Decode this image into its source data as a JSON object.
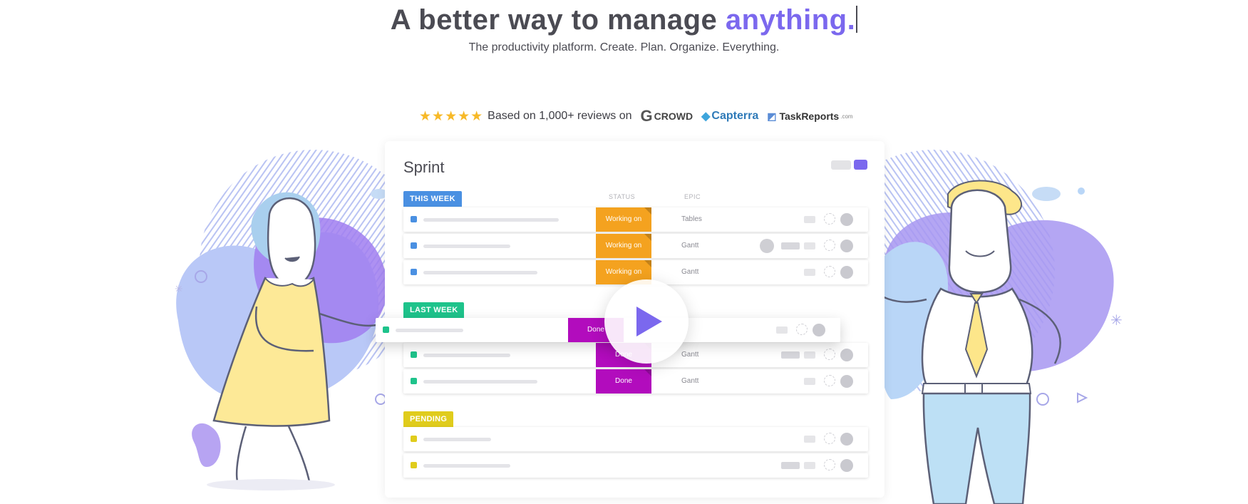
{
  "hero": {
    "title_main": "A better way to manage ",
    "title_accent": "anything.",
    "subtitle": "The productivity platform. Create. Plan. Organize. Everything."
  },
  "reviews": {
    "stars": "★★★★★",
    "text": "Based on 1,000+ reviews on",
    "logos": {
      "g2": "CROWD",
      "capterra": "Capterra",
      "taskreports": "TaskReports",
      "taskreports_domain": ".com"
    }
  },
  "board": {
    "title": "Sprint",
    "columns": {
      "status": "STATUS",
      "epic": "EPIC"
    },
    "groups": [
      {
        "label": "THIS WEEK",
        "color": "#4a90e2",
        "rows": [
          {
            "status": "Working on",
            "epic": "Tables"
          },
          {
            "status": "Working on",
            "epic": "Gantt"
          },
          {
            "status": "Working on",
            "epic": "Gantt"
          }
        ]
      },
      {
        "label": "LAST WEEK",
        "color": "#1ec38b",
        "rows": [
          {
            "status": "Done",
            "epic": ""
          },
          {
            "status": "Done",
            "epic": "Gantt"
          },
          {
            "status": "Done",
            "epic": "Gantt"
          }
        ]
      },
      {
        "label": "PENDING",
        "color": "#e0cc1c",
        "rows": [
          {
            "status": "",
            "epic": ""
          },
          {
            "status": "",
            "epic": ""
          }
        ]
      }
    ]
  },
  "colors": {
    "accent": "#7b68ee",
    "working": "#f4a21f",
    "done": "#b20cbd"
  },
  "icons": {
    "video": "play-icon",
    "rating": "star-icon"
  }
}
